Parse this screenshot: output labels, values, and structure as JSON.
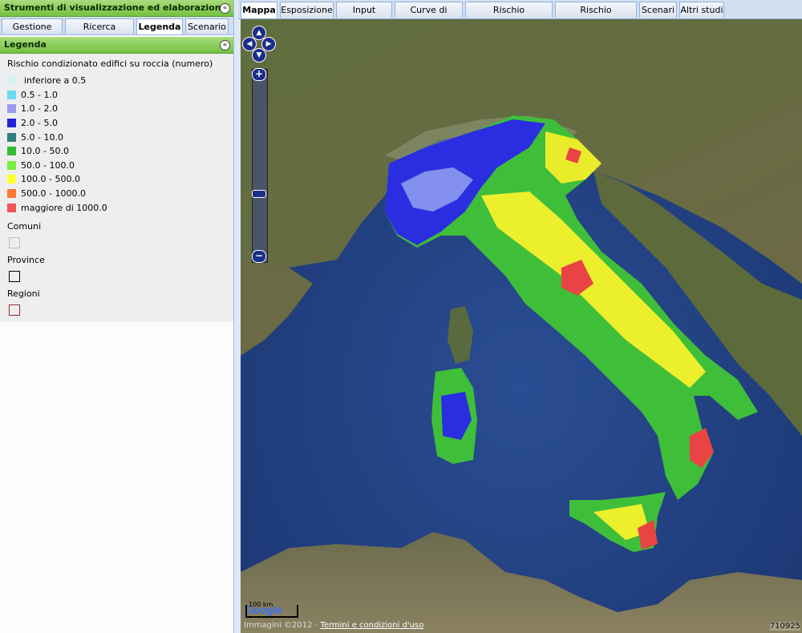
{
  "left_panel": {
    "title": "Strumenti di visualizzazione ed elaborazione",
    "collapse_glyph": "«",
    "tabs": [
      {
        "label": "Gestione layer",
        "active": false
      },
      {
        "label": "Ricerca Comune",
        "active": false
      },
      {
        "label": "Legenda",
        "active": true
      },
      {
        "label": "Scenario",
        "active": false
      }
    ]
  },
  "legend": {
    "header": "Legenda",
    "title": "Rischio condizionato edifici su roccia (numero)",
    "classes": [
      {
        "label": "inferiore a 0.5",
        "color": "#d6f4f4"
      },
      {
        "label": "0.5 - 1.0",
        "color": "#6fd9f3"
      },
      {
        "label": "1.0 - 2.0",
        "color": "#9b9bf0"
      },
      {
        "label": "2.0 - 5.0",
        "color": "#2222dd"
      },
      {
        "label": "5.0 - 10.0",
        "color": "#2f7f7a"
      },
      {
        "label": "10.0 - 50.0",
        "color": "#33bb33"
      },
      {
        "label": "50.0 - 100.0",
        "color": "#77ee44"
      },
      {
        "label": "100.0 - 500.0",
        "color": "#ffff33"
      },
      {
        "label": "500.0 - 1000.0",
        "color": "#ff7733"
      },
      {
        "label": "maggiore di 1000.0",
        "color": "#ee5555"
      }
    ],
    "layers": [
      {
        "label": "Comuni",
        "border_color": "#bdbdbd"
      },
      {
        "label": "Province",
        "border_color": "#000000"
      },
      {
        "label": "Regioni",
        "border_color": "#8b2a2a"
      }
    ]
  },
  "map_tabs": [
    {
      "label": "Mappa",
      "active": true
    },
    {
      "label": "Esposizione",
      "active": false
    },
    {
      "label": "Input sismico",
      "active": false
    },
    {
      "label": "Curve di fragilità",
      "active": false
    },
    {
      "label": "Rischio incondizionato",
      "active": false
    },
    {
      "label": "Rischio condizionato",
      "active": false
    },
    {
      "label": "Scenari",
      "active": false
    },
    {
      "label": "Altri studi",
      "active": false
    }
  ],
  "map": {
    "zoom_in_glyph": "+",
    "zoom_out_glyph": "−",
    "zoom_level_fraction": 0.66,
    "scale_label": "100 km",
    "logo_text": "Google",
    "attribution_prefix": "Immagini ©2012 -",
    "terms_link": "Termini e condizioni d'uso",
    "coordinate_readout": "710925",
    "icons": {
      "pan_up": "▲",
      "pan_down": "▼",
      "pan_left": "◀",
      "pan_right": "▶"
    }
  }
}
